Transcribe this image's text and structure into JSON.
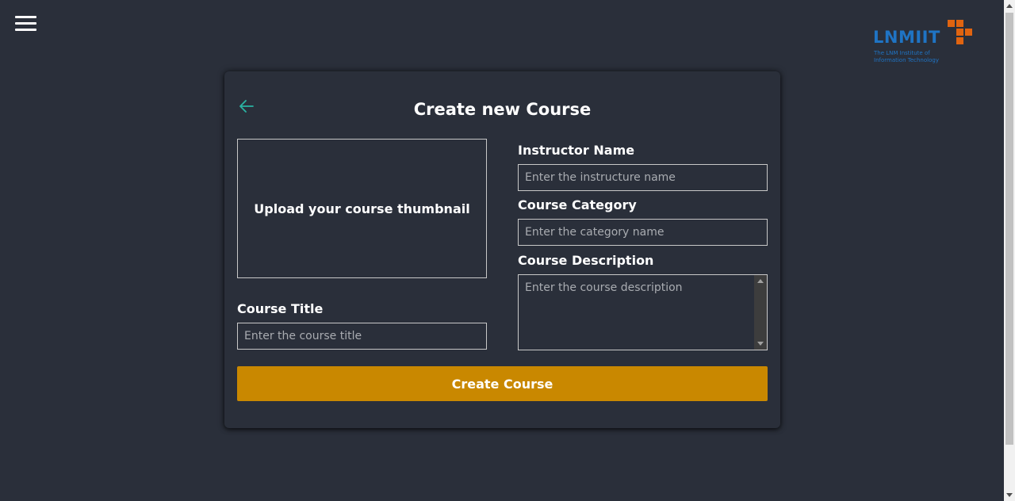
{
  "nav": {
    "menu_icon": "hamburger-menu-icon"
  },
  "logo": {
    "wordmark": "LNMIIT",
    "tagline": "The LNM Institute of Information Technology",
    "text_color": "#1f74c4",
    "block_color": "#e06410"
  },
  "form": {
    "back_icon": "arrow-left-icon",
    "title": "Create new Course",
    "upload_label": "Upload your course thumbnail",
    "course_title": {
      "label": "Course Title",
      "placeholder": "Enter the course title",
      "value": ""
    },
    "instructor": {
      "label": "Instructor Name",
      "placeholder": "Enter the instructure name",
      "value": ""
    },
    "category": {
      "label": "Course Category",
      "placeholder": "Enter the category name",
      "value": ""
    },
    "description": {
      "label": "Course Description",
      "placeholder": "Enter the course description",
      "value": ""
    },
    "submit_label": "Create Course"
  },
  "colors": {
    "background": "#2a2f3a",
    "accent_button": "#c98800",
    "back_arrow": "#2ab3a2",
    "border": "#c8c8c8"
  }
}
